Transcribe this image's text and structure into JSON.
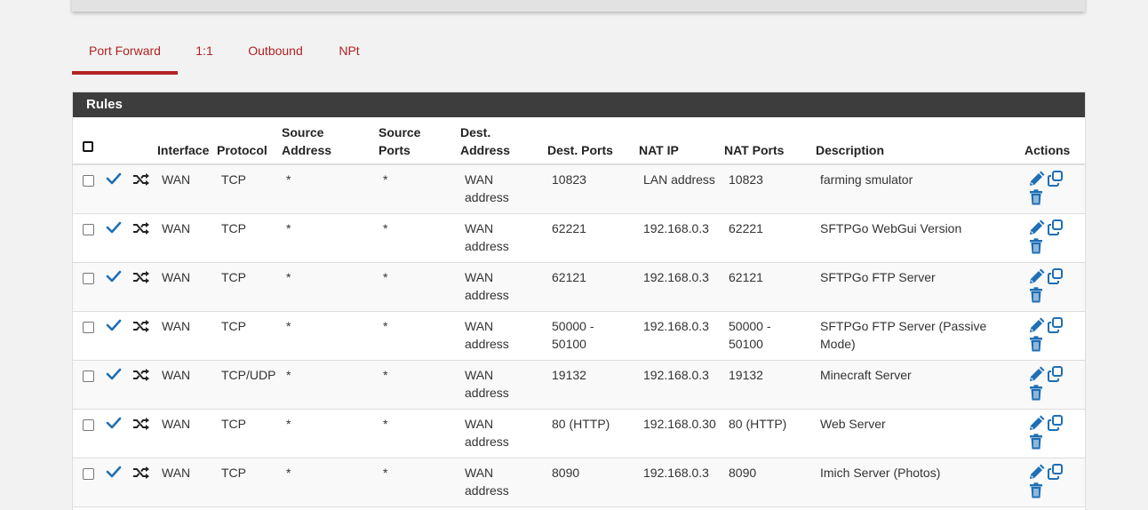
{
  "tabs": [
    {
      "label": "Port Forward",
      "active": true
    },
    {
      "label": "1:1",
      "active": false
    },
    {
      "label": "Outbound",
      "active": false
    },
    {
      "label": "NPt",
      "active": false
    }
  ],
  "panel": {
    "title": "Rules",
    "columns": {
      "interface": "Interface",
      "protocol": "Protocol",
      "source_address": "Source Address",
      "source_ports": "Source Ports",
      "dest_address": "Dest. Address",
      "dest_ports": "Dest. Ports",
      "nat_ip": "NAT IP",
      "nat_ports": "NAT Ports",
      "description": "Description",
      "actions": "Actions"
    }
  },
  "rules": [
    {
      "interface": "WAN",
      "protocol": "TCP",
      "source_address": "*",
      "source_ports": "*",
      "dest_address": "WAN address",
      "dest_ports": "10823",
      "nat_ip": "LAN address",
      "nat_ports": "10823",
      "description": "farming smulator"
    },
    {
      "interface": "WAN",
      "protocol": "TCP",
      "source_address": "*",
      "source_ports": "*",
      "dest_address": "WAN address",
      "dest_ports": "62221",
      "nat_ip": "192.168.0.3",
      "nat_ports": "62221",
      "description": "SFTPGo WebGui Version"
    },
    {
      "interface": "WAN",
      "protocol": "TCP",
      "source_address": "*",
      "source_ports": "*",
      "dest_address": "WAN address",
      "dest_ports": "62121",
      "nat_ip": "192.168.0.3",
      "nat_ports": "62121",
      "description": "SFTPGo FTP Server"
    },
    {
      "interface": "WAN",
      "protocol": "TCP",
      "source_address": "*",
      "source_ports": "*",
      "dest_address": "WAN address",
      "dest_ports": "50000 - 50100",
      "nat_ip": "192.168.0.3",
      "nat_ports": "50000 - 50100",
      "description": "SFTPGo FTP Server (Passive Mode)"
    },
    {
      "interface": "WAN",
      "protocol": "TCP/UDP",
      "source_address": "*",
      "source_ports": "*",
      "dest_address": "WAN address",
      "dest_ports": "19132",
      "nat_ip": "192.168.0.3",
      "nat_ports": "19132",
      "description": "Minecraft Server"
    },
    {
      "interface": "WAN",
      "protocol": "TCP",
      "source_address": "*",
      "source_ports": "*",
      "dest_address": "WAN address",
      "dest_ports": "80 (HTTP)",
      "nat_ip": "192.168.0.30",
      "nat_ports": "80 (HTTP)",
      "description": "Web Server"
    },
    {
      "interface": "WAN",
      "protocol": "TCP",
      "source_address": "*",
      "source_ports": "*",
      "dest_address": "WAN address",
      "dest_ports": "8090",
      "nat_ip": "192.168.0.3",
      "nat_ports": "8090",
      "description": "Imich Server (Photos)"
    }
  ],
  "icons": {
    "enabled": "check-icon",
    "nat_reflection": "shuffle-icon",
    "edit": "pencil-icon",
    "copy": "copy-icon",
    "delete": "trash-icon"
  },
  "colors": {
    "accent": "#b22222",
    "icon_blue": "#1e6fb5",
    "panel_heading": "#3d3d3d"
  }
}
